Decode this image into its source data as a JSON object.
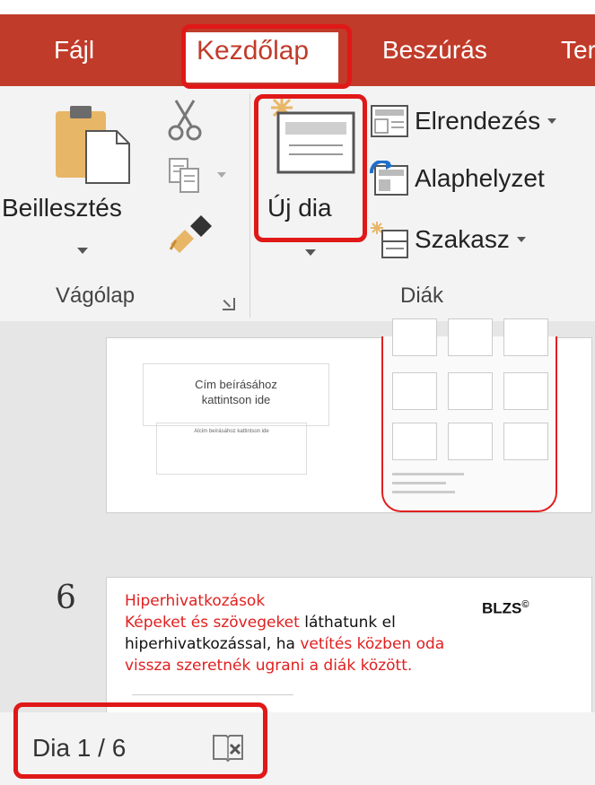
{
  "ribbon": {
    "tabs": [
      {
        "label": "Fájl"
      },
      {
        "label": "Kezdőlap",
        "selected": true
      },
      {
        "label": "Beszúrás"
      },
      {
        "label": "Ter"
      }
    ],
    "clipboard_group": {
      "label": "Vágólap",
      "paste_label": "Beillesztés"
    },
    "slides_group": {
      "label": "Diák",
      "new_slide_label": "Új dia",
      "layout_label": "Elrendezés",
      "reset_label": "Alaphelyzet",
      "section_label": "Szakasz"
    }
  },
  "slides": {
    "thumb5": {
      "title_placeholder_1": "Cím beírásához",
      "title_placeholder_2": "kattintson ide",
      "subtitle_placeholder": "Alcím beírásához kattintson ide"
    },
    "thumb6": {
      "number": "6",
      "line1": "Hiperhivatkozások",
      "line2_red": "Képeket és szövegeket",
      "line2_black": " láthatunk el",
      "line3_black": "hiperhivatkozással, ha ",
      "line3_red": "vetítés közben oda",
      "line4": "vissza szeretnék ugrani a diák között.",
      "logo_text": "BLZS",
      "logo_mark": "©"
    }
  },
  "statusbar": {
    "slide_indicator": "Dia 1 / 6"
  },
  "icons": [
    "paste-icon",
    "cut-icon",
    "copy-icon",
    "format-painter-icon",
    "new-slide-icon",
    "layout-icon",
    "reset-icon",
    "section-icon",
    "notes-icon"
  ],
  "colors": {
    "ribbon_tab_bg": "#c13b2a",
    "highlight": "#e01818",
    "slide_text_red": "#e02020"
  }
}
